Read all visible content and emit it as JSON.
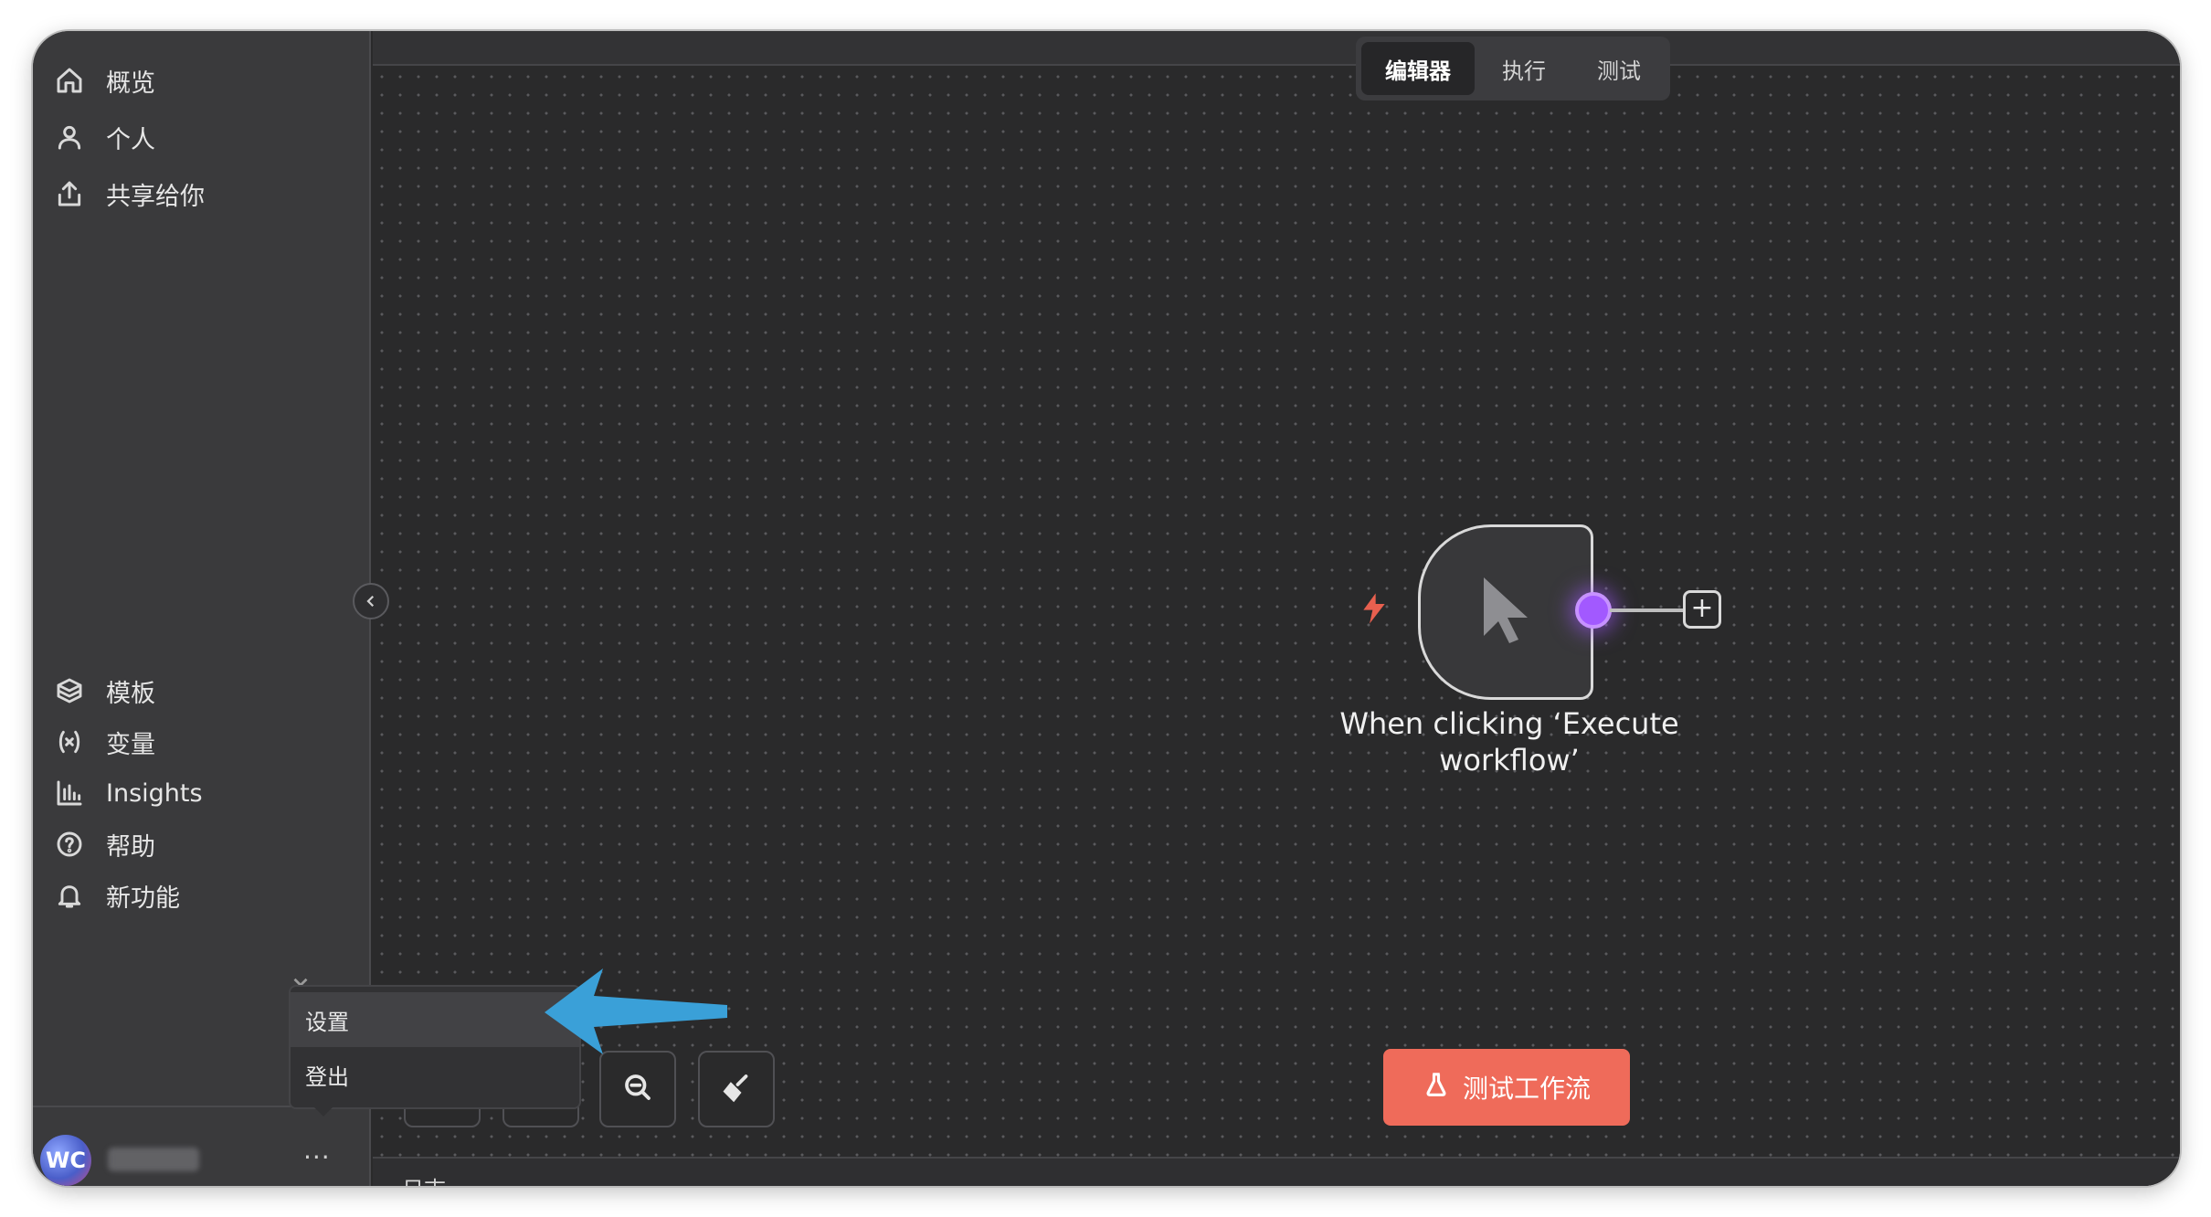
{
  "sidebar": {
    "top_items": [
      {
        "label": "概览",
        "icon": "home-icon"
      },
      {
        "label": "个人",
        "icon": "user-icon"
      },
      {
        "label": "共享给你",
        "icon": "share-icon"
      }
    ],
    "bottom_items": [
      {
        "label": "模板",
        "icon": "box-icon"
      },
      {
        "label": "变量",
        "icon": "variable-icon"
      },
      {
        "label": "Insights",
        "icon": "bar-chart-icon"
      },
      {
        "label": "帮助",
        "icon": "help-icon"
      },
      {
        "label": "新功能",
        "icon": "bell-icon"
      }
    ],
    "user": {
      "initials": "WC",
      "menu_glyph": "···"
    }
  },
  "user_menu": {
    "items": [
      {
        "label": "设置"
      },
      {
        "label": "登出"
      }
    ]
  },
  "header": {
    "tabs": [
      {
        "label": "编辑器",
        "active": true
      },
      {
        "label": "执行",
        "active": false
      },
      {
        "label": "测试",
        "active": false
      }
    ]
  },
  "canvas": {
    "trigger_node": {
      "label_line1": "When clicking ‘Execute",
      "label_line2": "workflow’",
      "icon": "cursor-icon",
      "connector_color": "#a259ff"
    },
    "add_button_label": "+",
    "test_button_label": "测试工作流",
    "test_button_color": "#ef6b5a",
    "log_label": "日志"
  },
  "annotation": {
    "arrow_color": "#3aa0d8"
  }
}
